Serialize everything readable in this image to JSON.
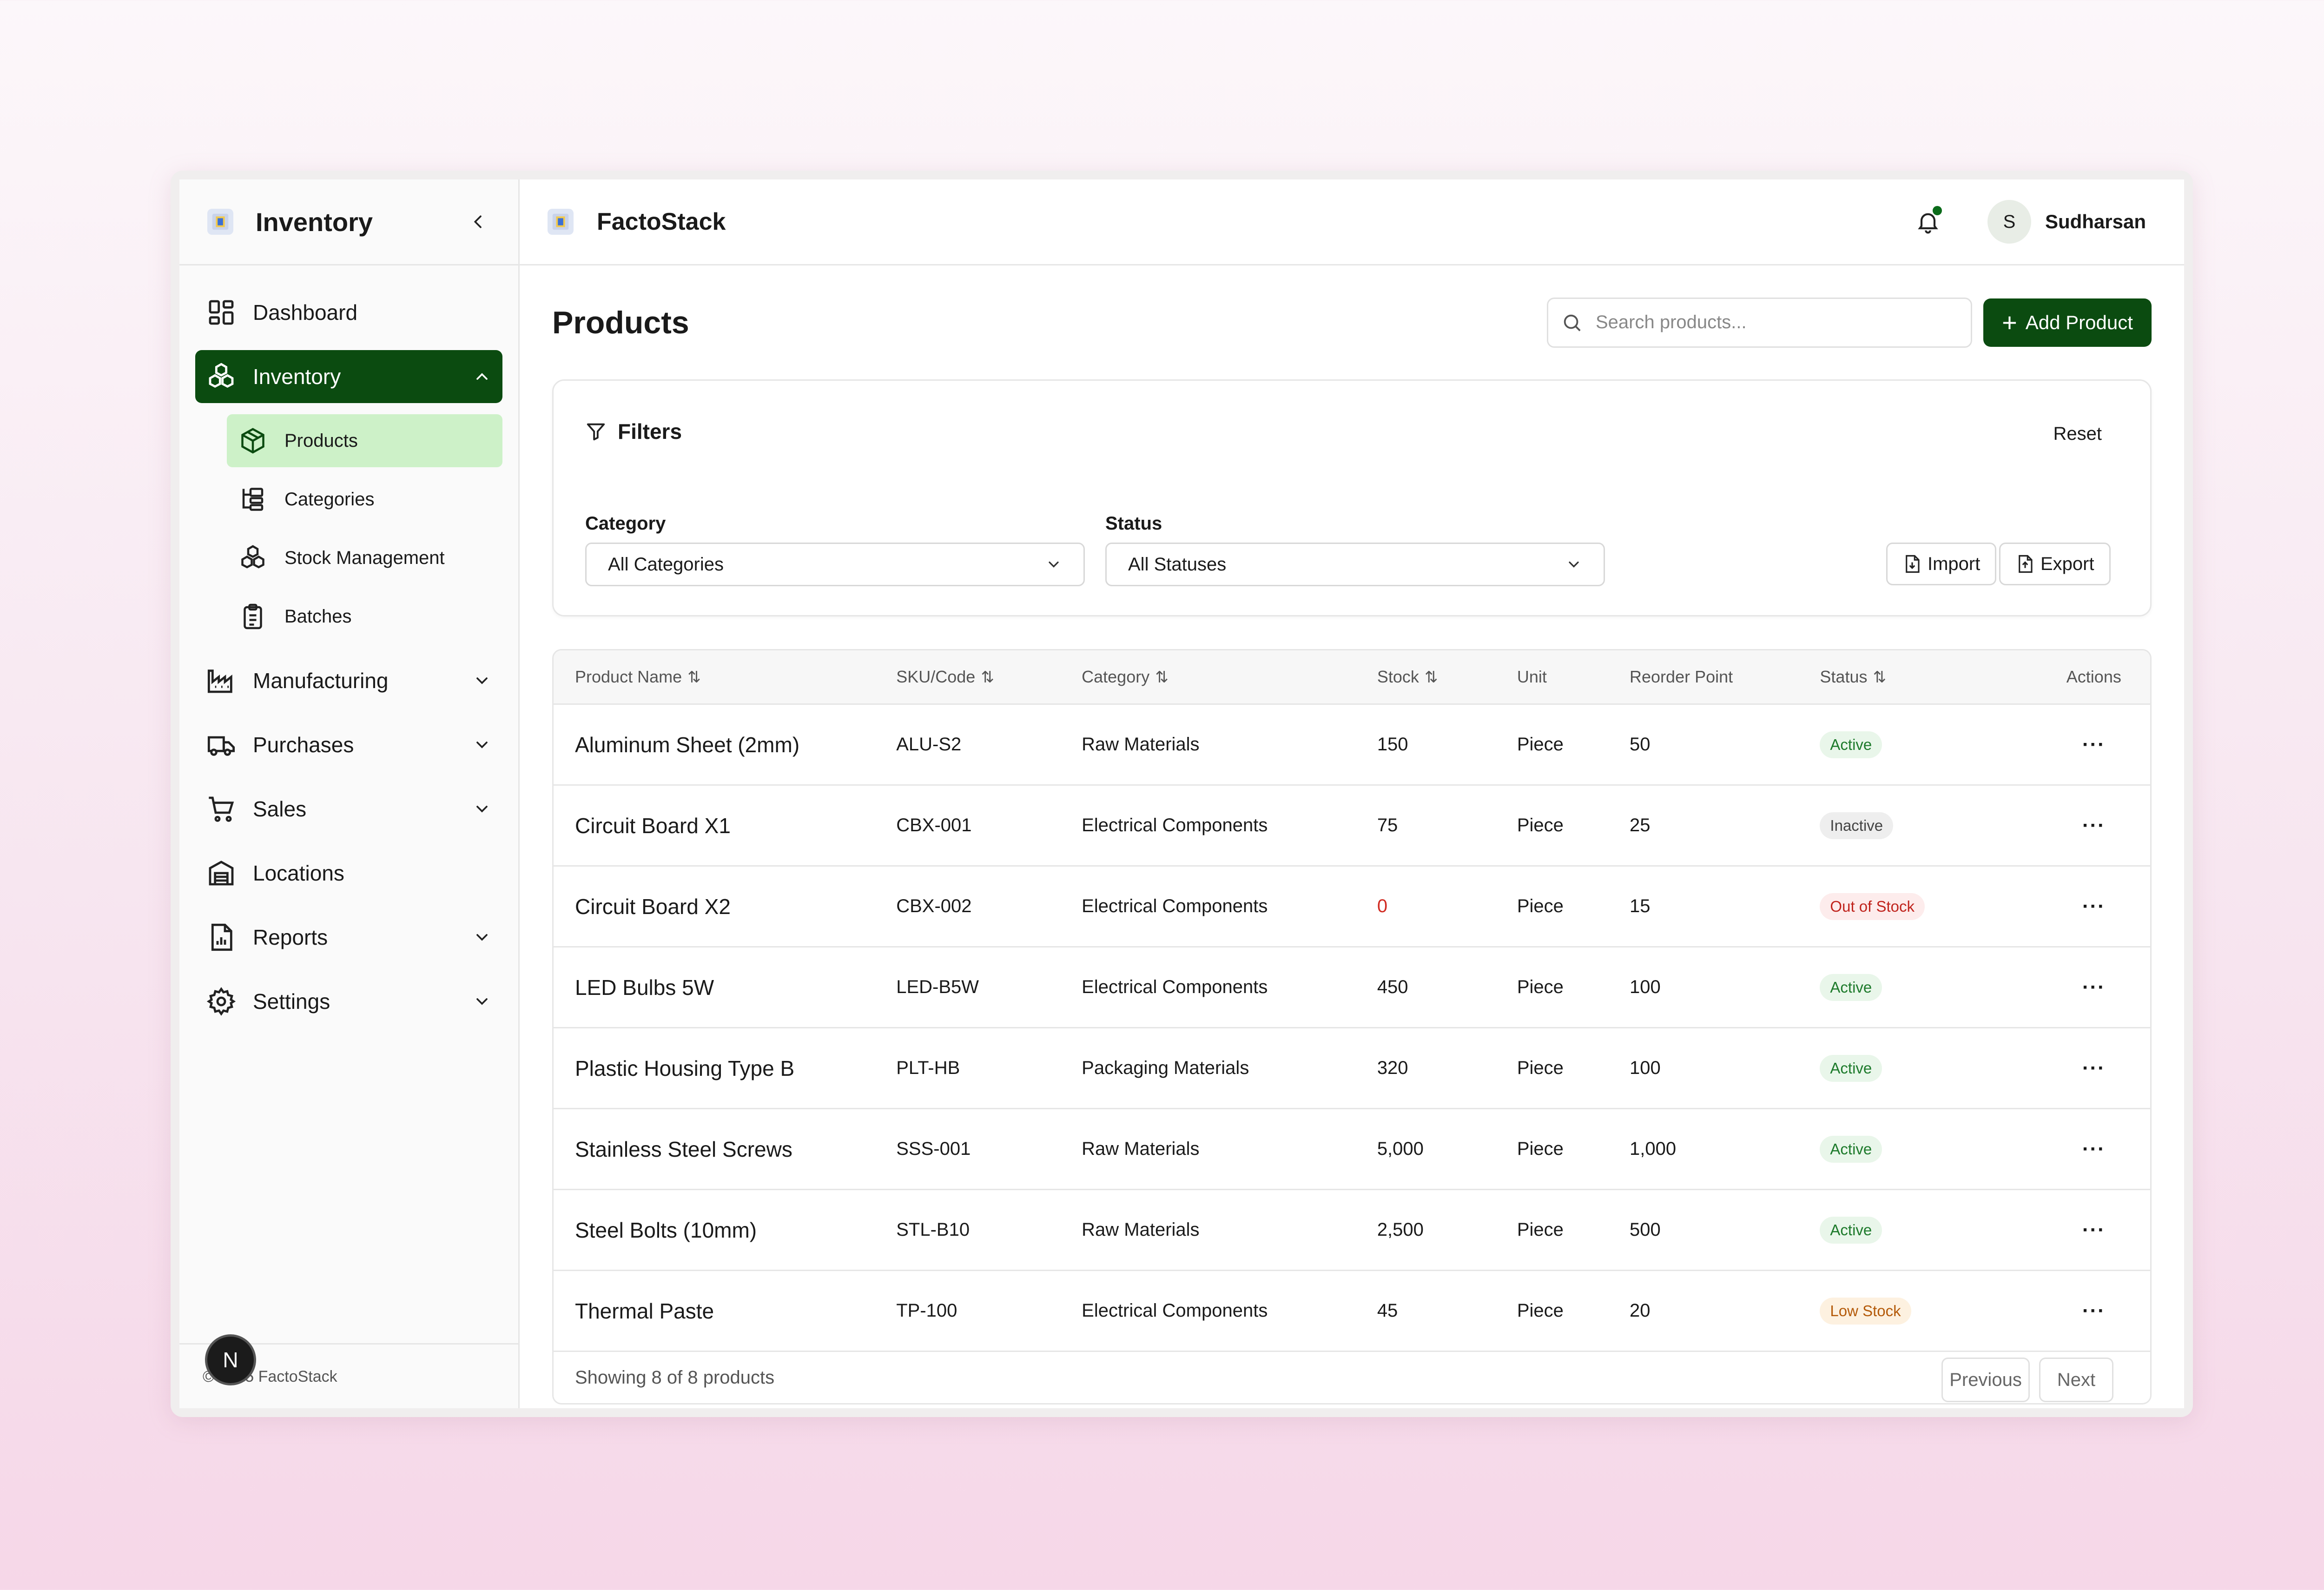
{
  "sidebar": {
    "title": "Inventory",
    "items": [
      {
        "label": "Dashboard"
      },
      {
        "label": "Inventory"
      },
      {
        "label": "Manufacturing"
      },
      {
        "label": "Purchases"
      },
      {
        "label": "Sales"
      },
      {
        "label": "Locations"
      },
      {
        "label": "Reports"
      },
      {
        "label": "Settings"
      }
    ],
    "sub_items": [
      {
        "label": "Products"
      },
      {
        "label": "Categories"
      },
      {
        "label": "Stock Management"
      },
      {
        "label": "Batches"
      }
    ],
    "footer": "© 2025 FactoStack",
    "badge": "N"
  },
  "topbar": {
    "brand": "FactoStack",
    "user_initial": "S",
    "user_name": "Sudharsan"
  },
  "page": {
    "title": "Products",
    "search_placeholder": "Search products...",
    "add_label": "Add Product"
  },
  "filters": {
    "title": "Filters",
    "reset": "Reset",
    "category_label": "Category",
    "category_value": "All Categories",
    "status_label": "Status",
    "status_value": "All Statuses",
    "import": "Import",
    "export": "Export"
  },
  "table": {
    "headers": [
      "Product Name",
      "SKU/Code",
      "Category",
      "Stock",
      "Unit",
      "Reorder Point",
      "Status",
      "Actions"
    ],
    "rows": [
      {
        "name": "Aluminum Sheet (2mm)",
        "sku": "ALU-S2",
        "category": "Raw Materials",
        "stock": "150",
        "unit": "Piece",
        "reorder": "50",
        "status": "Active"
      },
      {
        "name": "Circuit Board X1",
        "sku": "CBX-001",
        "category": "Electrical Components",
        "stock": "75",
        "unit": "Piece",
        "reorder": "25",
        "status": "Inactive"
      },
      {
        "name": "Circuit Board X2",
        "sku": "CBX-002",
        "category": "Electrical Components",
        "stock": "0",
        "unit": "Piece",
        "reorder": "15",
        "status": "Out of Stock"
      },
      {
        "name": "LED Bulbs 5W",
        "sku": "LED-B5W",
        "category": "Electrical Components",
        "stock": "450",
        "unit": "Piece",
        "reorder": "100",
        "status": "Active"
      },
      {
        "name": "Plastic Housing Type B",
        "sku": "PLT-HB",
        "category": "Packaging Materials",
        "stock": "320",
        "unit": "Piece",
        "reorder": "100",
        "status": "Active"
      },
      {
        "name": "Stainless Steel Screws",
        "sku": "SSS-001",
        "category": "Raw Materials",
        "stock": "5,000",
        "unit": "Piece",
        "reorder": "1,000",
        "status": "Active"
      },
      {
        "name": "Steel Bolts (10mm)",
        "sku": "STL-B10",
        "category": "Raw Materials",
        "stock": "2,500",
        "unit": "Piece",
        "reorder": "500",
        "status": "Active"
      },
      {
        "name": "Thermal Paste",
        "sku": "TP-100",
        "category": "Electrical Components",
        "stock": "45",
        "unit": "Piece",
        "reorder": "20",
        "status": "Low Stock"
      }
    ],
    "footer_text": "Showing 8 of 8 products",
    "prev": "Previous",
    "next": "Next"
  },
  "colors": {
    "primary": "#0b4b10",
    "active_sub": "#cdf1c8",
    "active_badge": "#1d7a2b",
    "out_badge": "#c0241d",
    "low_badge": "#b45a09"
  }
}
